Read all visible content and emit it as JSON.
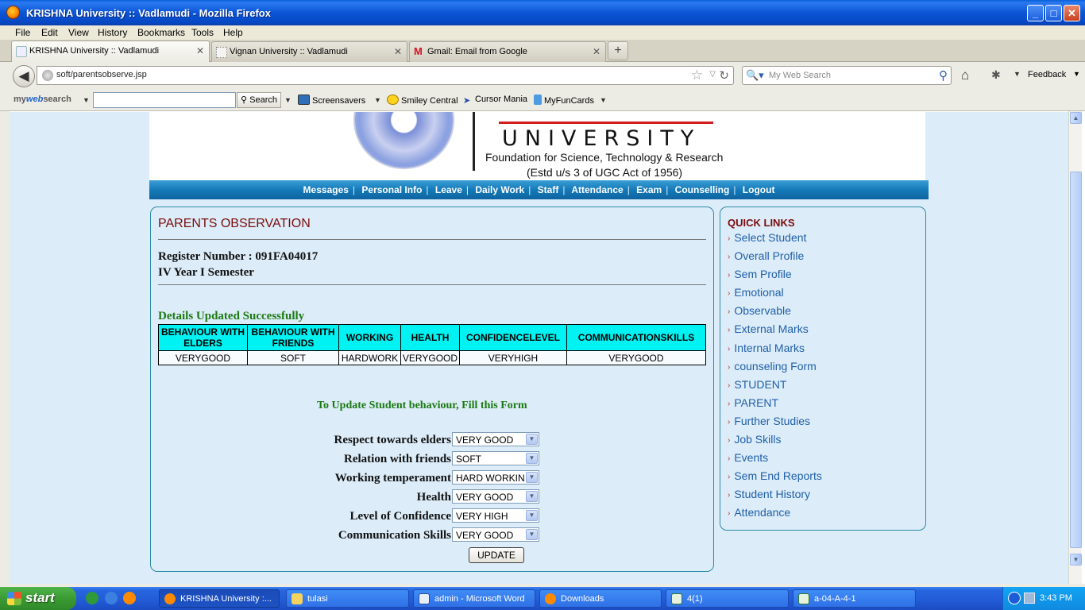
{
  "window": {
    "title": "KRISHNA University :: Vadlamudi - Mozilla Firefox",
    "min_label": "_",
    "max_label": "□",
    "close_label": "✕"
  },
  "menu": [
    "File",
    "Edit",
    "View",
    "History",
    "Bookmarks",
    "Tools",
    "Help"
  ],
  "tabs": [
    {
      "label": "KRISHNA University :: Vadlamudi",
      "active": true
    },
    {
      "label": "Vignan University :: Vadlamudi",
      "active": false
    },
    {
      "label": "Gmail: Email from Google",
      "active": false
    }
  ],
  "newtab_label": "+",
  "nav": {
    "url": "soft/parentsobserve.jsp",
    "search_placeholder": "My Web Search",
    "feedback": "Feedback"
  },
  "toolbar": {
    "logo_my": "my",
    "logo_web": "web",
    "logo_search": "search",
    "search_button": "Search",
    "items": [
      "Screensavers",
      "Smiley Central",
      "Cursor Mania",
      "MyFunCards"
    ]
  },
  "banner": {
    "university": "UNIVERSITY",
    "foundation": "Foundation for Science, Technology & Research",
    "estd": "(Estd u/s 3 of UGC Act of 1956)"
  },
  "site_nav": [
    "Messages",
    "Personal Info",
    "Leave",
    "Daily Work",
    "Staff",
    "Attendance",
    "Exam",
    "Counselling",
    "Logout"
  ],
  "page": {
    "heading": "PARENTS OBSERVATION",
    "register_line": "Register Number : 091FA04017",
    "semester_line": "IV Year I Semester",
    "success": "Details Updated Successfully",
    "table": {
      "headers": [
        "BEHAVIOUR WITH ELDERS",
        "BEHAVIOUR WITH FRIENDS",
        "WORKING",
        "HEALTH",
        "CONFIDENCELEVEL",
        "COMMUNICATIONSKILLS"
      ],
      "row": [
        "VERYGOOD",
        "SOFT",
        "HARDWORK",
        "VERYGOOD",
        "VERYHIGH",
        "VERYGOOD"
      ]
    },
    "form_title": "To Update Student behaviour, Fill this Form",
    "form": [
      {
        "label": "Respect towards elders",
        "value": "VERY GOOD"
      },
      {
        "label": "Relation with friends",
        "value": "SOFT"
      },
      {
        "label": "Working temperament",
        "value": "HARD WORKING"
      },
      {
        "label": "Health",
        "value": "VERY GOOD"
      },
      {
        "label": "Level of Confidence",
        "value": "VERY HIGH"
      },
      {
        "label": "Communication Skills",
        "value": "VERY GOOD"
      }
    ],
    "update_button": "UPDATE"
  },
  "quick_links": {
    "heading": "QUICK LINKS",
    "items": [
      "Select Student",
      "Overall Profile",
      "Sem Profile",
      "Emotional",
      "Observable",
      "External Marks",
      "Internal Marks",
      "counseling Form",
      "STUDENT",
      "PARENT",
      "Further Studies",
      "Job Skills",
      "Events",
      "Sem End Reports",
      "Student History",
      "Attendance"
    ]
  },
  "taskbar": {
    "start": "start",
    "tasks": [
      {
        "label": "KRISHNA University :...",
        "active": true
      },
      {
        "label": "tulasi",
        "active": false
      },
      {
        "label": "admin - Microsoft Word",
        "active": false
      },
      {
        "label": "Downloads",
        "active": false
      },
      {
        "label": "4(1)",
        "active": false
      },
      {
        "label": "a-04-A-4-1",
        "active": false
      }
    ],
    "clock": "3:43 PM"
  }
}
